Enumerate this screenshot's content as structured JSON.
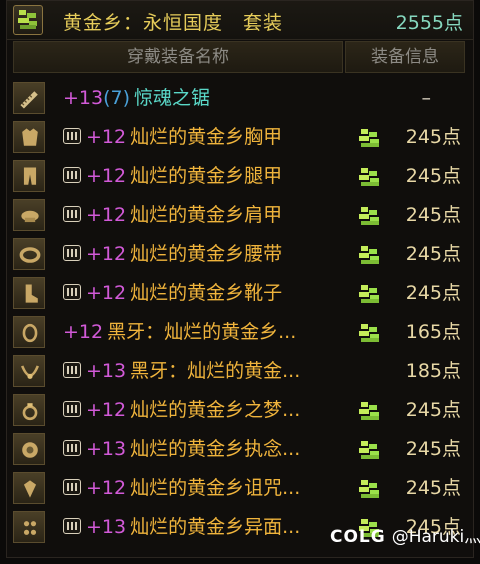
{
  "header": {
    "icon": "set-icon",
    "title": "黄金乡：永恒国度　套装",
    "points": "2555点"
  },
  "columns": {
    "name": "穿戴装备名称",
    "info": "装备信息"
  },
  "rows": [
    {
      "slot_icon": "saw-weapon-icon",
      "lvl": "+13",
      "amp": "(7)",
      "name": "惊魂之锯",
      "name_color": "cyan",
      "badge": false,
      "set_mark": false,
      "pts": "–"
    },
    {
      "slot_icon": "chest-armor-icon",
      "lvl": "+12",
      "amp": "",
      "name": "灿烂的黄金乡胸甲",
      "name_color": "gold",
      "badge": true,
      "set_mark": true,
      "pts": "245点"
    },
    {
      "slot_icon": "legs-armor-icon",
      "lvl": "+12",
      "amp": "",
      "name": "灿烂的黄金乡腿甲",
      "name_color": "gold",
      "badge": true,
      "set_mark": true,
      "pts": "245点"
    },
    {
      "slot_icon": "shoulder-armor-icon",
      "lvl": "+12",
      "amp": "",
      "name": "灿烂的黄金乡肩甲",
      "name_color": "gold",
      "badge": true,
      "set_mark": true,
      "pts": "245点"
    },
    {
      "slot_icon": "belt-icon",
      "lvl": "+12",
      "amp": "",
      "name": "灿烂的黄金乡腰带",
      "name_color": "gold",
      "badge": true,
      "set_mark": true,
      "pts": "245点"
    },
    {
      "slot_icon": "boots-icon",
      "lvl": "+12",
      "amp": "",
      "name": "灿烂的黄金乡靴子",
      "name_color": "gold",
      "badge": true,
      "set_mark": true,
      "pts": "245点"
    },
    {
      "slot_icon": "bracelet-icon",
      "lvl": "+12",
      "amp": "",
      "name": "黑牙：灿烂的黄金乡...",
      "name_color": "gold",
      "badge": false,
      "set_mark": true,
      "pts": "165点"
    },
    {
      "slot_icon": "necklace-icon",
      "lvl": "+13",
      "amp": "",
      "name": "黑牙：灿烂的黄金...",
      "name_color": "gold",
      "badge": true,
      "set_mark": false,
      "pts": "185点"
    },
    {
      "slot_icon": "ring-icon",
      "lvl": "+12",
      "amp": "",
      "name": "灿烂的黄金乡之梦...",
      "name_color": "gold",
      "badge": true,
      "set_mark": true,
      "pts": "245点"
    },
    {
      "slot_icon": "support-icon",
      "lvl": "+13",
      "amp": "",
      "name": "灿烂的黄金乡执念...",
      "name_color": "gold",
      "badge": true,
      "set_mark": true,
      "pts": "245点"
    },
    {
      "slot_icon": "magic-stone-icon",
      "lvl": "+12",
      "amp": "",
      "name": "灿烂的黄金乡诅咒...",
      "name_color": "gold",
      "badge": true,
      "set_mark": true,
      "pts": "245点"
    },
    {
      "slot_icon": "earring-icon",
      "lvl": "+13",
      "amp": "",
      "name": "灿烂的黄金乡异面...",
      "name_color": "gold",
      "badge": true,
      "set_mark": true,
      "pts": "245点"
    }
  ],
  "watermark": {
    "brand": "COLG",
    "user": "@Haruki灬"
  },
  "colors": {
    "gold_name": "#f0b43c",
    "cyan_name": "#5ad8c8",
    "level_magenta": "#d25ad8",
    "set_points": "#86d8bf",
    "set_mark_green": "#9be04a"
  }
}
